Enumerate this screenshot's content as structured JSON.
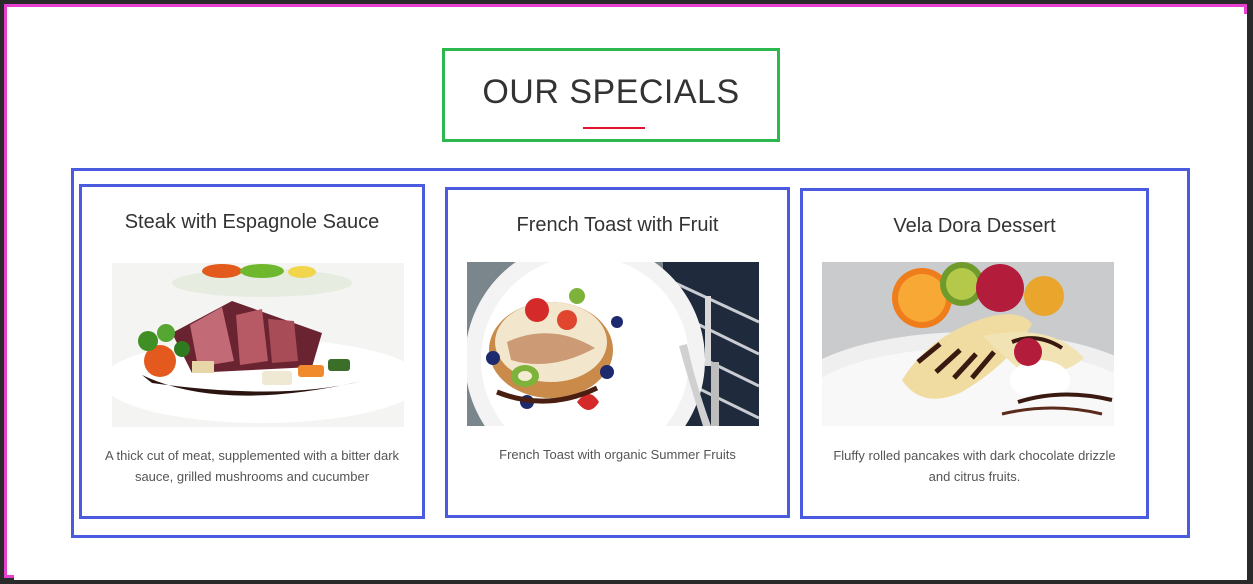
{
  "section": {
    "title": "OUR SPECIALS",
    "accent_underline_color": "#e0142c"
  },
  "specials": [
    {
      "title": "Steak with Espagnole Sauce",
      "image_icon": "steak-plate-image",
      "description": "A thick cut of meat, supplemented with a bitter dark sauce, grilled mushrooms and cucumber"
    },
    {
      "title": "French Toast with Fruit",
      "image_icon": "french-toast-plate-image",
      "description": "French Toast with organic Summer Fruits"
    },
    {
      "title": "Vela Dora Dessert",
      "image_icon": "banana-pancake-dessert-image",
      "description": "Fluffy rolled pancakes with dark chocolate drizzle and citrus fruits."
    }
  ],
  "colors": {
    "page_border": "#e83fd0",
    "heading_border": "#2db84f",
    "card_border": "#4b5be0"
  }
}
